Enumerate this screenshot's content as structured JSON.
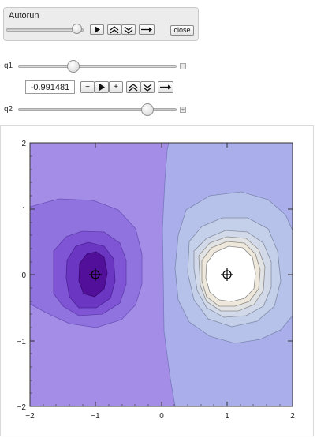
{
  "autorun": {
    "title": "Autorun",
    "play_icon": "play-icon",
    "faster_icon": "double-chevron-up-icon",
    "slower_icon": "double-chevron-down-icon",
    "direction_icon": "arrow-right-icon",
    "close_label": "close"
  },
  "params": {
    "q1": {
      "label": "q1",
      "value": "-0.991481",
      "expand_icon": "minus-icon",
      "controls": {
        "minus": "−",
        "plus": "+"
      }
    },
    "q2": {
      "label": "q2",
      "expand_icon": "plus-icon"
    }
  },
  "chart_data": {
    "type": "contour",
    "x_ticks": [
      "−2",
      "−1",
      "0",
      "1",
      "2"
    ],
    "y_ticks": [
      "2",
      "1",
      "0",
      "−1",
      "−2"
    ],
    "xlim": [
      -2,
      2
    ],
    "ylim": [
      -2,
      2
    ],
    "charges": [
      {
        "x": -1,
        "y": 0,
        "sign": "negative"
      },
      {
        "x": 1,
        "y": 0,
        "sign": "positive"
      }
    ],
    "colors": {
      "background_left": "#a38de6",
      "background_right": "#aaaeea",
      "neg_levels": [
        "#9173e0",
        "#7f55d6",
        "#6a36c2",
        "#520f99"
      ],
      "pos_levels": [
        "#b7c2ea",
        "#c4d0ea",
        "#d2d9e8",
        "#e2e3e4",
        "#ede7dc",
        "#ffffff"
      ]
    }
  }
}
